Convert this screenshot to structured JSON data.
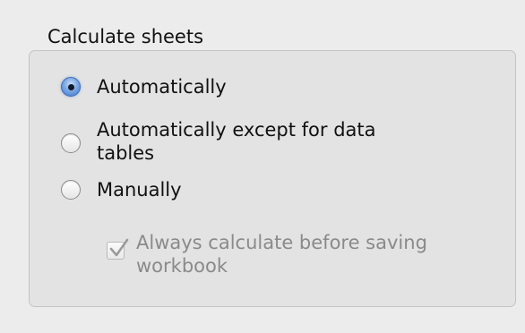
{
  "group": {
    "title": "Calculate sheets"
  },
  "options": {
    "automatically": {
      "label": "Automatically",
      "selected": true
    },
    "except_data_tables": {
      "label": "Automatically except for data tables",
      "selected": false
    },
    "manually": {
      "label": "Manually",
      "selected": false
    }
  },
  "always_calculate": {
    "label": "Always calculate before saving workbook",
    "checked": true,
    "enabled": false
  },
  "icons": {
    "radio_selected": "radio-selected-icon",
    "radio_unselected": "radio-unselected-icon",
    "checkmark": "checkmark-icon"
  },
  "colors": {
    "accent": "#3d75c8",
    "disabled_text": "#8a8a8a",
    "panel_background": "#e3e3e3"
  }
}
